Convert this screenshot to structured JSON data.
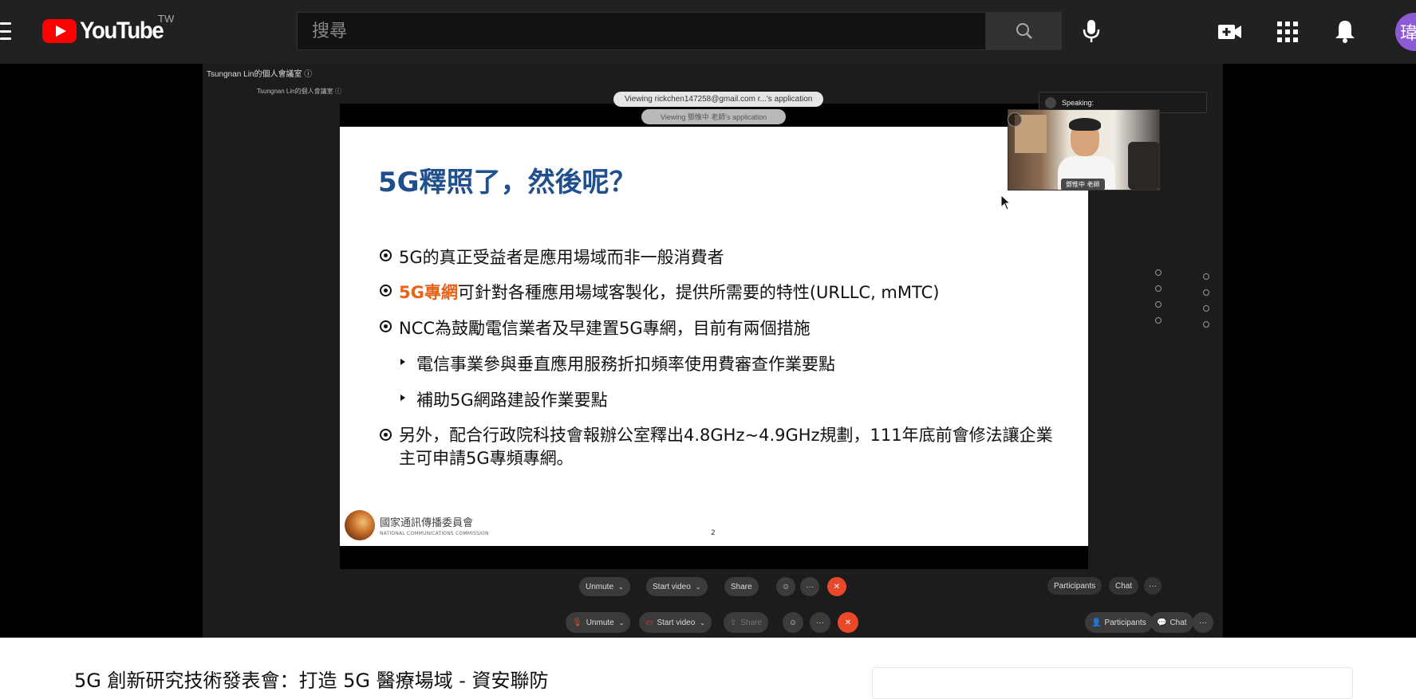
{
  "header": {
    "logo_text": "YouTube",
    "region": "TW",
    "search_placeholder": "搜尋",
    "avatar_letter": "瑋"
  },
  "meeting": {
    "title_outer": "Tsungnan Lin的個人會議室 ⓘ",
    "title_inner": "Tsungnan Lin的個人會議室 ⓘ",
    "viewing_front": "Viewing rickchen147258@gmail.com r...'s application",
    "viewing_back": "Viewing 鄧惟中 老師's application",
    "speaking_label": "Speaking:",
    "speaker_name": "鄧惟中 老師"
  },
  "slide": {
    "title": "5G釋照了，然後呢？",
    "bullet1": "5G的真正受益者是應用場域而非一般消費者",
    "bullet2_highlight": "5G專網",
    "bullet2_rest": "可針對各種應用場域客製化，提供所需要的特性(URLLC, mMTC)",
    "bullet3": "NCC為鼓勵電信業者及早建置5G專網，目前有兩個措施",
    "sub1": "電信事業參與垂直應用服務折扣頻率使用費審查作業要點",
    "sub2": "補助5G網路建設作業要點",
    "bullet4": "另外，配合行政院科技會報辦公室釋出4.8GHz~4.9GHz規劃，111年底前會修法讓企業主可申請5G專頻專網。",
    "logo_cn": "國家通訊傳播委員會",
    "logo_en": "NATIONAL COMMUNICATIONS COMMISSION",
    "page_number": "2"
  },
  "controls": {
    "unmute": "Unmute",
    "start_video": "Start video",
    "share": "Share",
    "participants": "Participants",
    "chat": "Chat",
    "more": "···"
  },
  "below": {
    "video_title": "5G 創新研究技術發表會：打造 5G 醫療場域 - 資安聯防"
  },
  "colors": {
    "header_bg": "#212121",
    "youtube_red": "#ff0000",
    "slide_title_blue": "#1f4f8c",
    "highlight_orange": "#e8621a",
    "end_call_red": "#e9492a"
  }
}
